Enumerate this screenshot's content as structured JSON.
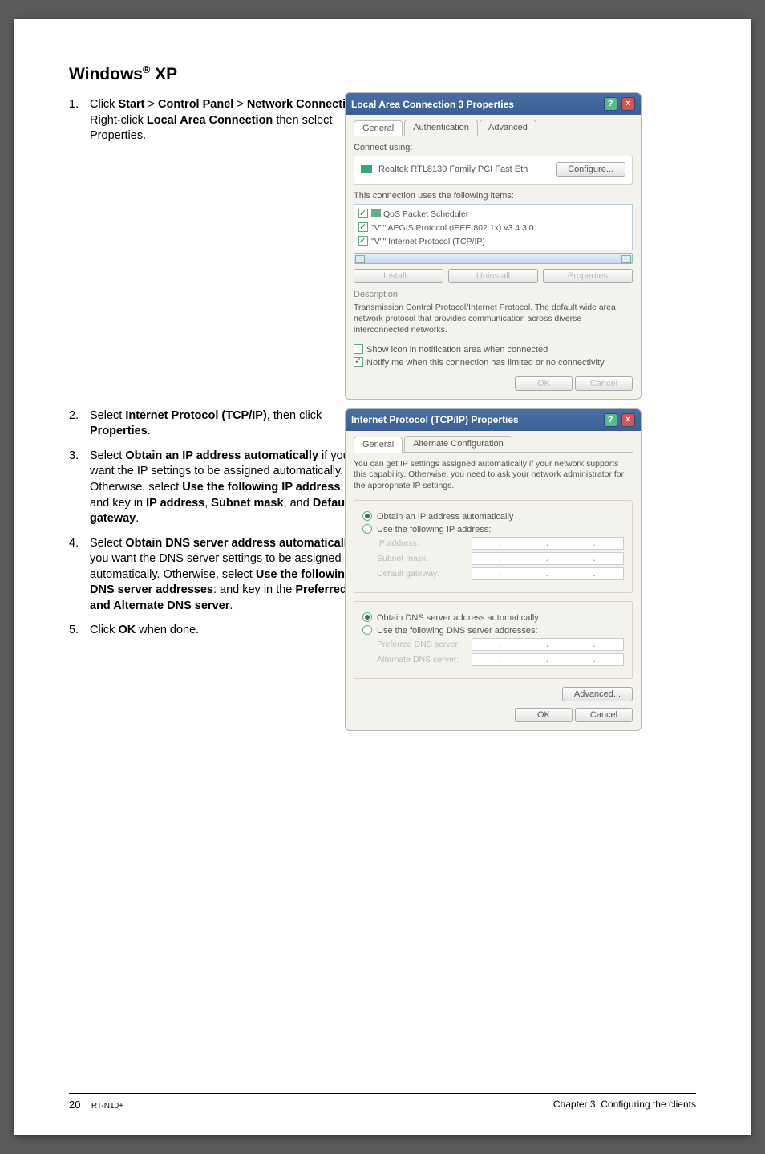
{
  "heading_html": "Windows® XP",
  "section1_steps": [
    {
      "num": "1.",
      "html": "Click <b>Start</b> > <b>Control Panel</b> > <b>Network Connection</b>. Right-click <b>Local Area Connection</b> then select Properties."
    }
  ],
  "section2_steps": [
    {
      "num": "2.",
      "html": "Select <b>Internet Protocol (TCP/IP)</b>, then click <b>Properties</b>."
    },
    {
      "num": "3.",
      "html": "Select <b>Obtain an IP address automatically</b> if you want the IP settings to be assigned automatically. Otherwise, select <b>Use the following IP address</b>: and key in <b>IP address</b>, <b>Subnet mask</b>, and <b>Default gateway</b>."
    },
    {
      "num": "4.",
      "html": "Select <b>Obtain DNS server address automatically</b> if you want the DNS server settings to be assigned automatically. Otherwise, select <b>Use the following DNS server addresses</b>: and key in the <b>Preferred and Alternate DNS server</b>."
    },
    {
      "num": "5.",
      "html": "Click <b>OK</b> when done."
    }
  ],
  "dialog1": {
    "title": "Local Area Connection 3 Properties",
    "tabs": [
      "General",
      "Authentication",
      "Advanced"
    ],
    "connect_using_label": "Connect using:",
    "adapter": "Realtek RTL8139 Family PCI Fast Eth",
    "configure_btn": "Configure...",
    "items_label": "This connection uses the following items:",
    "items": [
      "QoS Packet Scheduler",
      "\"V\"\" AEGIS Protocol (IEEE 802.1x) v3.4.3.0",
      "\"V\"\" Internet Protocol (TCP/IP)"
    ],
    "install_btn": "Install...",
    "uninstall_btn": "Uninstall",
    "properties_btn": "Properties",
    "desc_label": "Description",
    "desc_text": "Transmission Control Protocol/Internet Protocol. The default wide area network protocol that provides communication across diverse interconnected networks.",
    "show_icon": "Show icon in notification area when connected",
    "notify_limited": "Notify me when this connection has limited or no connectivity",
    "ok": "OK",
    "cancel": "Cancel"
  },
  "dialog2": {
    "title": "Internet Protocol (TCP/IP) Properties",
    "tabs": [
      "General",
      "Alternate Configuration"
    ],
    "intro": "You can get IP settings assigned automatically if your network supports this capability. Otherwise, you need to ask your network administrator for the appropriate IP settings.",
    "obtain_ip": "Obtain an IP address automatically",
    "use_ip": "Use the following IP address:",
    "ip_address": "IP address:",
    "subnet": "Subnet mask:",
    "gateway": "Default gateway:",
    "obtain_dns": "Obtain DNS server address automatically",
    "use_dns": "Use the following DNS server addresses:",
    "pref_dns": "Preferred DNS server:",
    "alt_dns": "Alternate DNS server:",
    "advanced_btn": "Advanced...",
    "ok": "OK",
    "cancel": "Cancel"
  },
  "footer": {
    "page": "20",
    "model": "RT-N10+",
    "chapter": "Chapter 3: Configuring the clients"
  }
}
